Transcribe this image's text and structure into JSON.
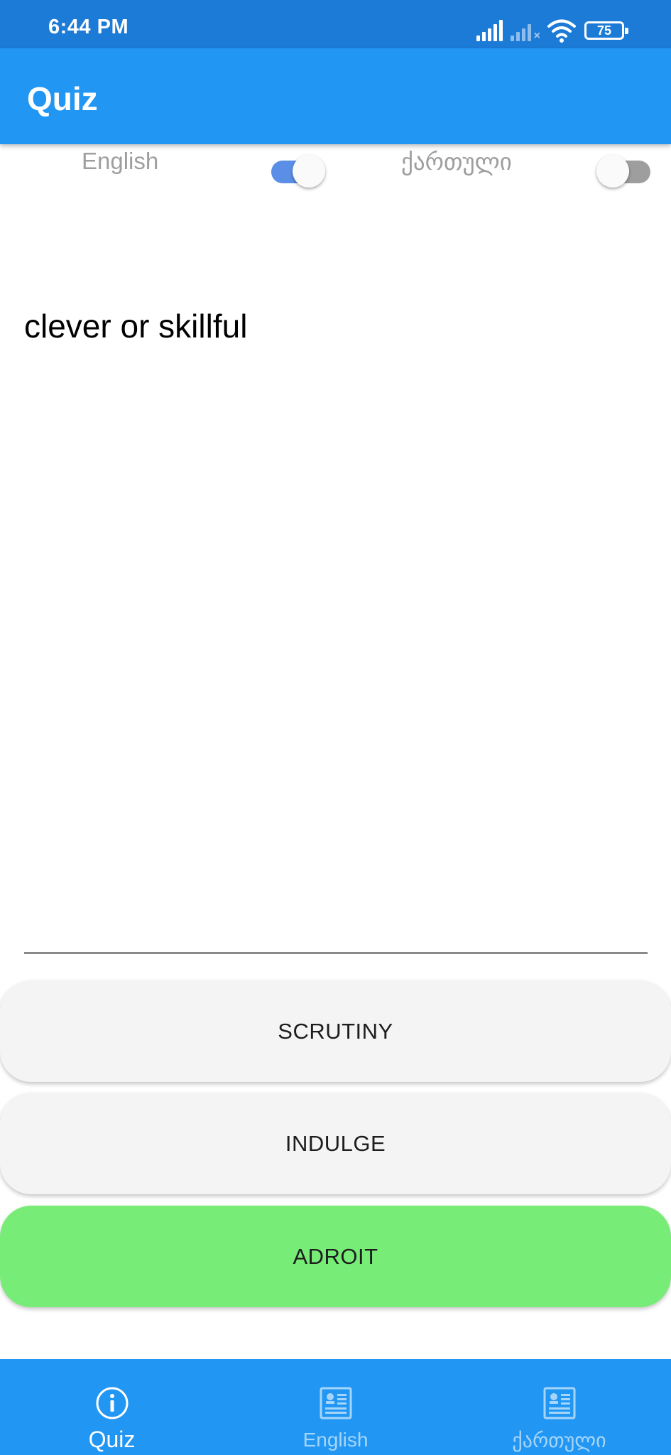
{
  "status_bar": {
    "time": "6:44 PM",
    "battery": "75",
    "icons": [
      "signal-icon",
      "signal-no-service-icon",
      "wifi-icon",
      "battery-icon"
    ]
  },
  "app_bar": {
    "title": "Quiz"
  },
  "toggles": {
    "english": {
      "label": "English",
      "state": "on"
    },
    "georgian": {
      "label": "ქართული",
      "state": "off"
    }
  },
  "question": {
    "text": "clever or skillful"
  },
  "answers": [
    {
      "label": "SCRUTINY",
      "color": "#f4f4f4"
    },
    {
      "label": "INDULGE",
      "color": "#f4f4f4"
    },
    {
      "label": "ADROIT",
      "color": "#77ec77"
    }
  ],
  "bottom_nav": {
    "items": [
      {
        "label": "Quiz",
        "icon": "info-icon",
        "active": true
      },
      {
        "label": "English",
        "icon": "article-icon",
        "active": false
      },
      {
        "label": "ქართული",
        "icon": "article-icon",
        "active": false
      }
    ]
  },
  "colors": {
    "status_bar": "#1c7bd6",
    "primary": "#2196f3",
    "switch_on": "#5b8ee6",
    "correct_answer": "#77ec77"
  }
}
